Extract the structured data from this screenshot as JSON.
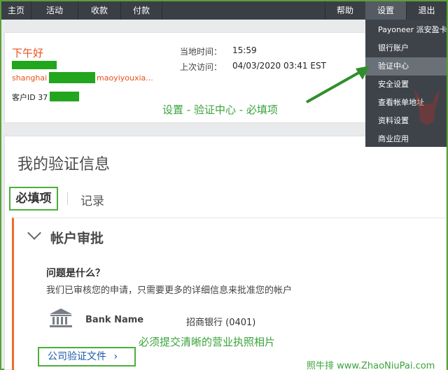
{
  "topnav": {
    "left": [
      "主页",
      "活动",
      "收款",
      "付款"
    ],
    "help": "帮助",
    "settings": "设置",
    "logout": "退出"
  },
  "dropdown": {
    "items": [
      "Payoneer 派安盈卡",
      "银行账户",
      "验证中心",
      "安全设置",
      "查看帐单地址",
      "资料设置",
      "商业应用"
    ],
    "highlighted_index": 2
  },
  "account": {
    "greeting": "下午好",
    "company_part1": "shanghai",
    "company_part2": "maoyiyouxia...",
    "customer_id": "客户ID 37"
  },
  "times": {
    "local_time_label": "当地时间：",
    "local_time_value": "15:59",
    "last_visit_label": "上次访问：",
    "last_visit_value": "04/03/2020 03:41 EST"
  },
  "annotation_top": "设置 - 验证中心 - 必填项",
  "verification": {
    "title": "我的验证信息",
    "tabs": [
      "必填项",
      "记录"
    ],
    "section_title": "帐户审批",
    "question": "问题是什么？",
    "description": "我们已审核您的申请，只需要更多的详细信息来批准您的帐户",
    "bank_label": "Bank Name",
    "bank_value": "招商银行 (0401)",
    "annotation_bottom": "必须提交清晰的营业执照相片",
    "doc_link": "公司验证文件"
  },
  "watermark": "照牛排 www.ZhaoNiuPai.com",
  "colors": {
    "nav_bg": "#3a3f45",
    "accent_orange": "#e8511b",
    "annotation_green": "#3aa33c",
    "redaction_green": "#21a61e",
    "link_blue": "#1a5aa8"
  }
}
